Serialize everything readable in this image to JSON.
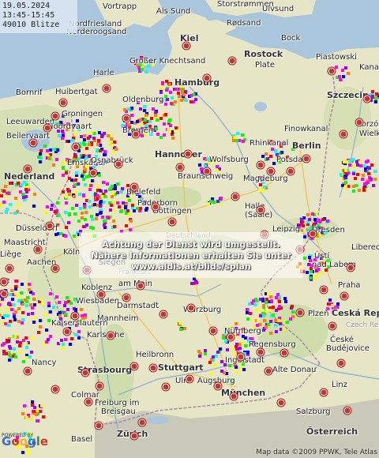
{
  "info": {
    "date": "19.05.2024",
    "time_range": "13:45-15:45",
    "count": "49010 Blitze"
  },
  "notice": {
    "line1": "Achtung der Dienst wird umgestellt.",
    "line2": "Nähere Informationen erhalten Sie unter",
    "line3": "www.aldis.at/blids/splan"
  },
  "attribution": {
    "powered": "POWERED BY",
    "google": "Google",
    "copyright": "Map data ©2009 PPWK, Tele Atlas"
  },
  "labels": {
    "vortrapp": "Vortrapp",
    "als_sund": "Als Sund",
    "storstroemmen": "Storstrømmen",
    "ulvsund": "Ulvsund",
    "rodsand": "Rødsand",
    "nordfriesland": "Nordfriesland",
    "norderoogsand": "Norderoogsand",
    "kiel": "Kiel",
    "bock": "Bock",
    "piastowski": "Piastowski",
    "kana": "Kana",
    "rostock": "Rostock",
    "grosser_knechtsand": "Großer Knechtsand",
    "harle": "Harle",
    "plate": "Plate",
    "hamburg": "Hamburg",
    "bornrif": "Bornrif",
    "huibertgat": "Huibertgat",
    "szczecin": "Szczecin",
    "oldenburg": "Oldenburg",
    "groningen": "Groningen",
    "leeuwarden": "Leeuwarden",
    "noordvaart": "Noordvaart",
    "finowkanal": "Finowkanal",
    "gorzow": "Gorzów",
    "wielkopolski": "Wielkopolski",
    "bremen": "Bremen",
    "beilervaart": "Beilervaart",
    "rhinkanal": "Rhinkanal",
    "berlin": "Berlin",
    "emskanal": "Emskanal",
    "hannover": "Hannover",
    "osnabrueck": "Osnabrück",
    "wolfsburg": "Wolfsburg",
    "potsdam": "Potsdam",
    "nederland": "Nederland",
    "braunschweig": "Braunschweig",
    "magdeburg": "Magdeburg",
    "bielefeld": "Bielefeld",
    "paderborn": "Paderborn",
    "goettingen": "Göttingen",
    "halle": "Halle",
    "saale": "(Saale)",
    "leipzig": "Leipzig",
    "duesseldorf": "Düsseldorf",
    "deutschland": "Deutschland",
    "dresden": "Dresden",
    "maastricht": "Maastricht",
    "koeln": "Köln",
    "liberec": "Liberec",
    "liege": "Liège",
    "aachen": "Aachen",
    "siegen": "Siegen",
    "ust": "Ústí",
    "nad_labem": "nad Labem",
    "frankfurt": "Frankfurt",
    "koblenz": "Koblenz",
    "am_main": "am Main",
    "praha": "Praha",
    "wiesbaden": "Wiesbaden",
    "darmstadt": "Darmstadt",
    "ceska_republika": "Česká Republika",
    "czech_republic": "Czech Republic",
    "plzen": "Plzeň",
    "wuerzburg": "Würzburg",
    "mannheim": "Mannheim",
    "kaiserslautern": "Kaiserslautern",
    "nuernberg": "Nürnberg",
    "karlsruhe": "Karlsruhe",
    "regensburg": "Regensburg",
    "ceske": "České",
    "budejovice": "Budějovice",
    "nancy": "Nancy",
    "heilbronn": "Heilbronn",
    "ingolstadt": "Ingolstadt",
    "stuttgart": "Stuttgart",
    "strasbourg": "Strasbourg",
    "alte_donau": "Alte Donau",
    "linz": "Linz",
    "ulm": "Ulm",
    "augsburg": "Augsburg",
    "muenchen": "München",
    "colmar": "Colmar",
    "freiburg1": "Freiburg im",
    "freiburg2": "Breisgau",
    "salzburg": "Salzburg",
    "basel": "Basel",
    "zuerich": "Zürich",
    "oesterreich": "Österreich",
    "ue": "ue",
    "ry": "ry"
  },
  "colors": {
    "water": "#a9c6dd",
    "land": "#e7e5c7",
    "forest": "#cddcab",
    "alps": "#c9c7b9",
    "city_dot": "#c8322e",
    "strike_palette": [
      "#ff0000",
      "#ff7f00",
      "#ffff00",
      "#00ff00",
      "#00ffff",
      "#0000ff",
      "#9900ff",
      "#ff00ff"
    ]
  }
}
